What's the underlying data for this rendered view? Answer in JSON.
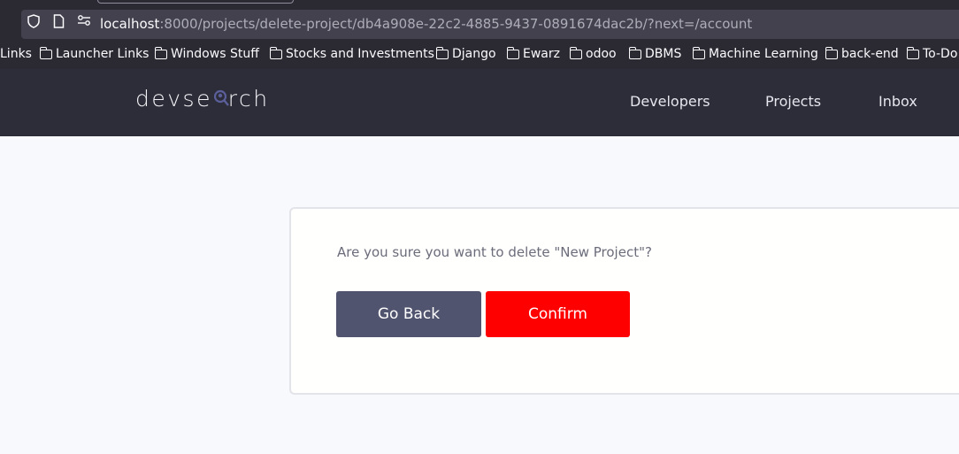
{
  "browser": {
    "url_host": "localhost",
    "url_rest": ":8000/projects/delete-project/db4a908e-22c2-4885-9437-0891674dac2b/?next=/account"
  },
  "bookmarks": [
    {
      "label": "Links",
      "folder": false
    },
    {
      "label": "Launcher Links",
      "folder": true
    },
    {
      "label": "Windows Stuff",
      "folder": true
    },
    {
      "label": "Stocks and Investments",
      "folder": true
    },
    {
      "label": "Django",
      "folder": true
    },
    {
      "label": "Ewarz",
      "folder": true
    },
    {
      "label": "odoo",
      "folder": true
    },
    {
      "label": "DBMS",
      "folder": true
    },
    {
      "label": "Machine Learning",
      "folder": true
    },
    {
      "label": "back-end",
      "folder": true
    },
    {
      "label": "To-Do",
      "folder": true
    }
  ],
  "header": {
    "logo_pre": "devse",
    "logo_post": "rch",
    "nav": [
      "Developers",
      "Projects",
      "Inbox"
    ]
  },
  "dialog": {
    "question": "Are you sure you want to delete \"New Project\"?",
    "back_label": "Go Back",
    "confirm_label": "Confirm"
  },
  "colors": {
    "header_bg": "#2d2d39",
    "back_button": "#51546e",
    "confirm_button": "#ff0000"
  }
}
